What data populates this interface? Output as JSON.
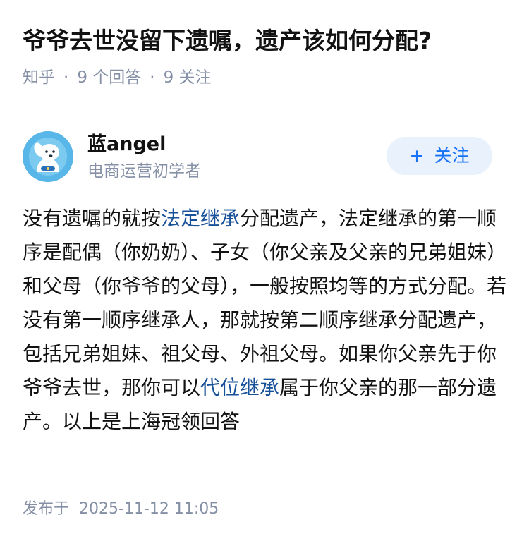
{
  "question": {
    "title": "爷爷去世没留下遗嘱，遗产该如何分配?",
    "source": "知乎",
    "separator": "·",
    "answers": "9 个回答",
    "followers": "9 关注"
  },
  "author": {
    "name": "蓝angel",
    "bio": "电商运营初学者",
    "follow_icon": "plus-icon",
    "follow_plus": "+",
    "follow_label": "关注"
  },
  "answer": {
    "part1": "没有遗嘱的就按",
    "link1": "法定继承",
    "part2": "分配遗产，法定继承的第一顺序是配偶（你奶奶）、子女（你父亲及父亲的兄弟姐妹）和父母（你爷爷的父母），一般按照均等的方式分配。若没有第一顺序继承人，那就按第二顺序继承分配遗产，包括兄弟姐妹、祖父母、外祖父母。如果你父亲先于你爷爷去世，那你可以",
    "link2": "代位继承",
    "part3": "属于你父亲的那一部分遗产。以上是上海冠领回答"
  },
  "footer": {
    "label": "发布于",
    "datetime": "2025-11-12 11:05"
  },
  "colors": {
    "link": "#175199",
    "meta": "#8590a6",
    "button_bg": "#e9f2fc",
    "button_text": "#1772f6",
    "avatar_bg": "#58b6e8"
  }
}
